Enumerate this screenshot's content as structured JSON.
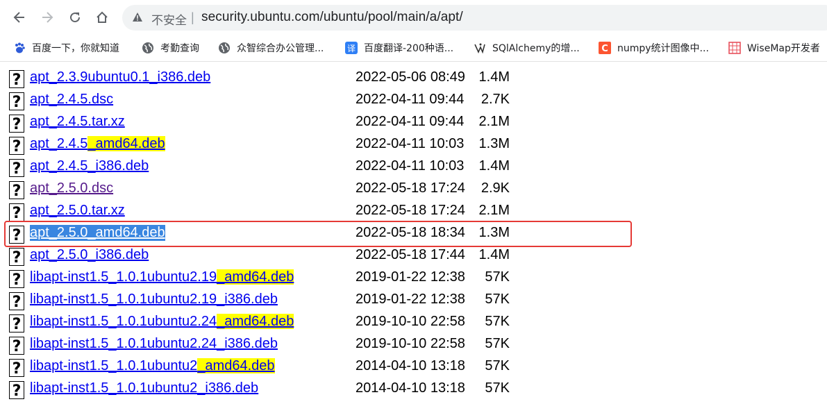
{
  "browser": {
    "insecure_label": "不安全",
    "url": "security.ubuntu.com/ubuntu/pool/main/a/apt/"
  },
  "bookmarks": [
    {
      "label": "百度一下，你就知道",
      "icon": "baidu-paw-icon"
    },
    {
      "label": "考勤查询",
      "icon": "globe-icon"
    },
    {
      "label": "众智综合办公管理...",
      "icon": "globe-icon"
    },
    {
      "label": "百度翻译-200种语...",
      "icon": "translate-icon"
    },
    {
      "label": "SQlAlchemy的增...",
      "icon": "sqlalchemy-icon"
    },
    {
      "label": "numpy统计图像中...",
      "icon": "csdn-icon"
    },
    {
      "label": "WiseMap开发者",
      "icon": "wisemap-icon"
    }
  ],
  "files": [
    {
      "parts": [
        "apt_2.3.9ubuntu0.1_i386.deb"
      ],
      "date": "2022-05-06 08:49",
      "size": "1.4M"
    },
    {
      "parts": [
        "apt_2.4.5.dsc"
      ],
      "date": "2022-04-11 09:44",
      "size": "2.7K"
    },
    {
      "parts": [
        "apt_2.4.5.tar.xz"
      ],
      "date": "2022-04-11 09:44",
      "size": "2.1M"
    },
    {
      "parts": [
        "apt_2.4.5",
        "_amd64.deb"
      ],
      "date": "2022-04-11 10:03",
      "size": "1.3M"
    },
    {
      "parts": [
        "apt_2.4.5_i386.deb"
      ],
      "date": "2022-04-11 10:03",
      "size": "1.4M"
    },
    {
      "parts": [
        "apt_2.5.0.dsc"
      ],
      "date": "2022-05-18 17:24",
      "size": "2.9K"
    },
    {
      "parts": [
        "apt_2.5.0.tar.xz"
      ],
      "date": "2022-05-18 17:24",
      "size": "2.1M"
    },
    {
      "parts": [
        "apt_2.5.0_amd64.deb"
      ],
      "date": "2022-05-18 18:34",
      "size": "1.3M"
    },
    {
      "parts": [
        "apt_2.5.0_i386.deb"
      ],
      "date": "2022-05-18 17:44",
      "size": "1.4M"
    },
    {
      "parts": [
        "libapt-inst1.5_1.0.1ubuntu2.19",
        "_amd64.deb"
      ],
      "date": "2019-01-22 12:38",
      "size": "57K"
    },
    {
      "parts": [
        "libapt-inst1.5_1.0.1ubuntu2.19_i386.deb"
      ],
      "date": "2019-01-22 12:38",
      "size": "57K"
    },
    {
      "parts": [
        "libapt-inst1.5_1.0.1ubuntu2.24",
        "_amd64.deb"
      ],
      "date": "2019-10-10 22:58",
      "size": "57K"
    },
    {
      "parts": [
        "libapt-inst1.5_1.0.1ubuntu2.24_i386.deb"
      ],
      "date": "2019-10-10 22:58",
      "size": "57K"
    },
    {
      "parts": [
        "libapt-inst1.5_1.0.1ubuntu2",
        "_amd64.deb"
      ],
      "date": "2014-04-10 13:18",
      "size": "57K"
    },
    {
      "parts": [
        "libapt-inst1.5_1.0.1ubuntu2_i386.deb"
      ],
      "date": "2014-04-10 13:18",
      "size": "57K"
    }
  ],
  "colors": {
    "link": "#0000ee",
    "visited_link": "#551a8b",
    "search_highlight": "#ffff00",
    "selection": "#3a86e0",
    "annotation_box": "#e53935"
  }
}
